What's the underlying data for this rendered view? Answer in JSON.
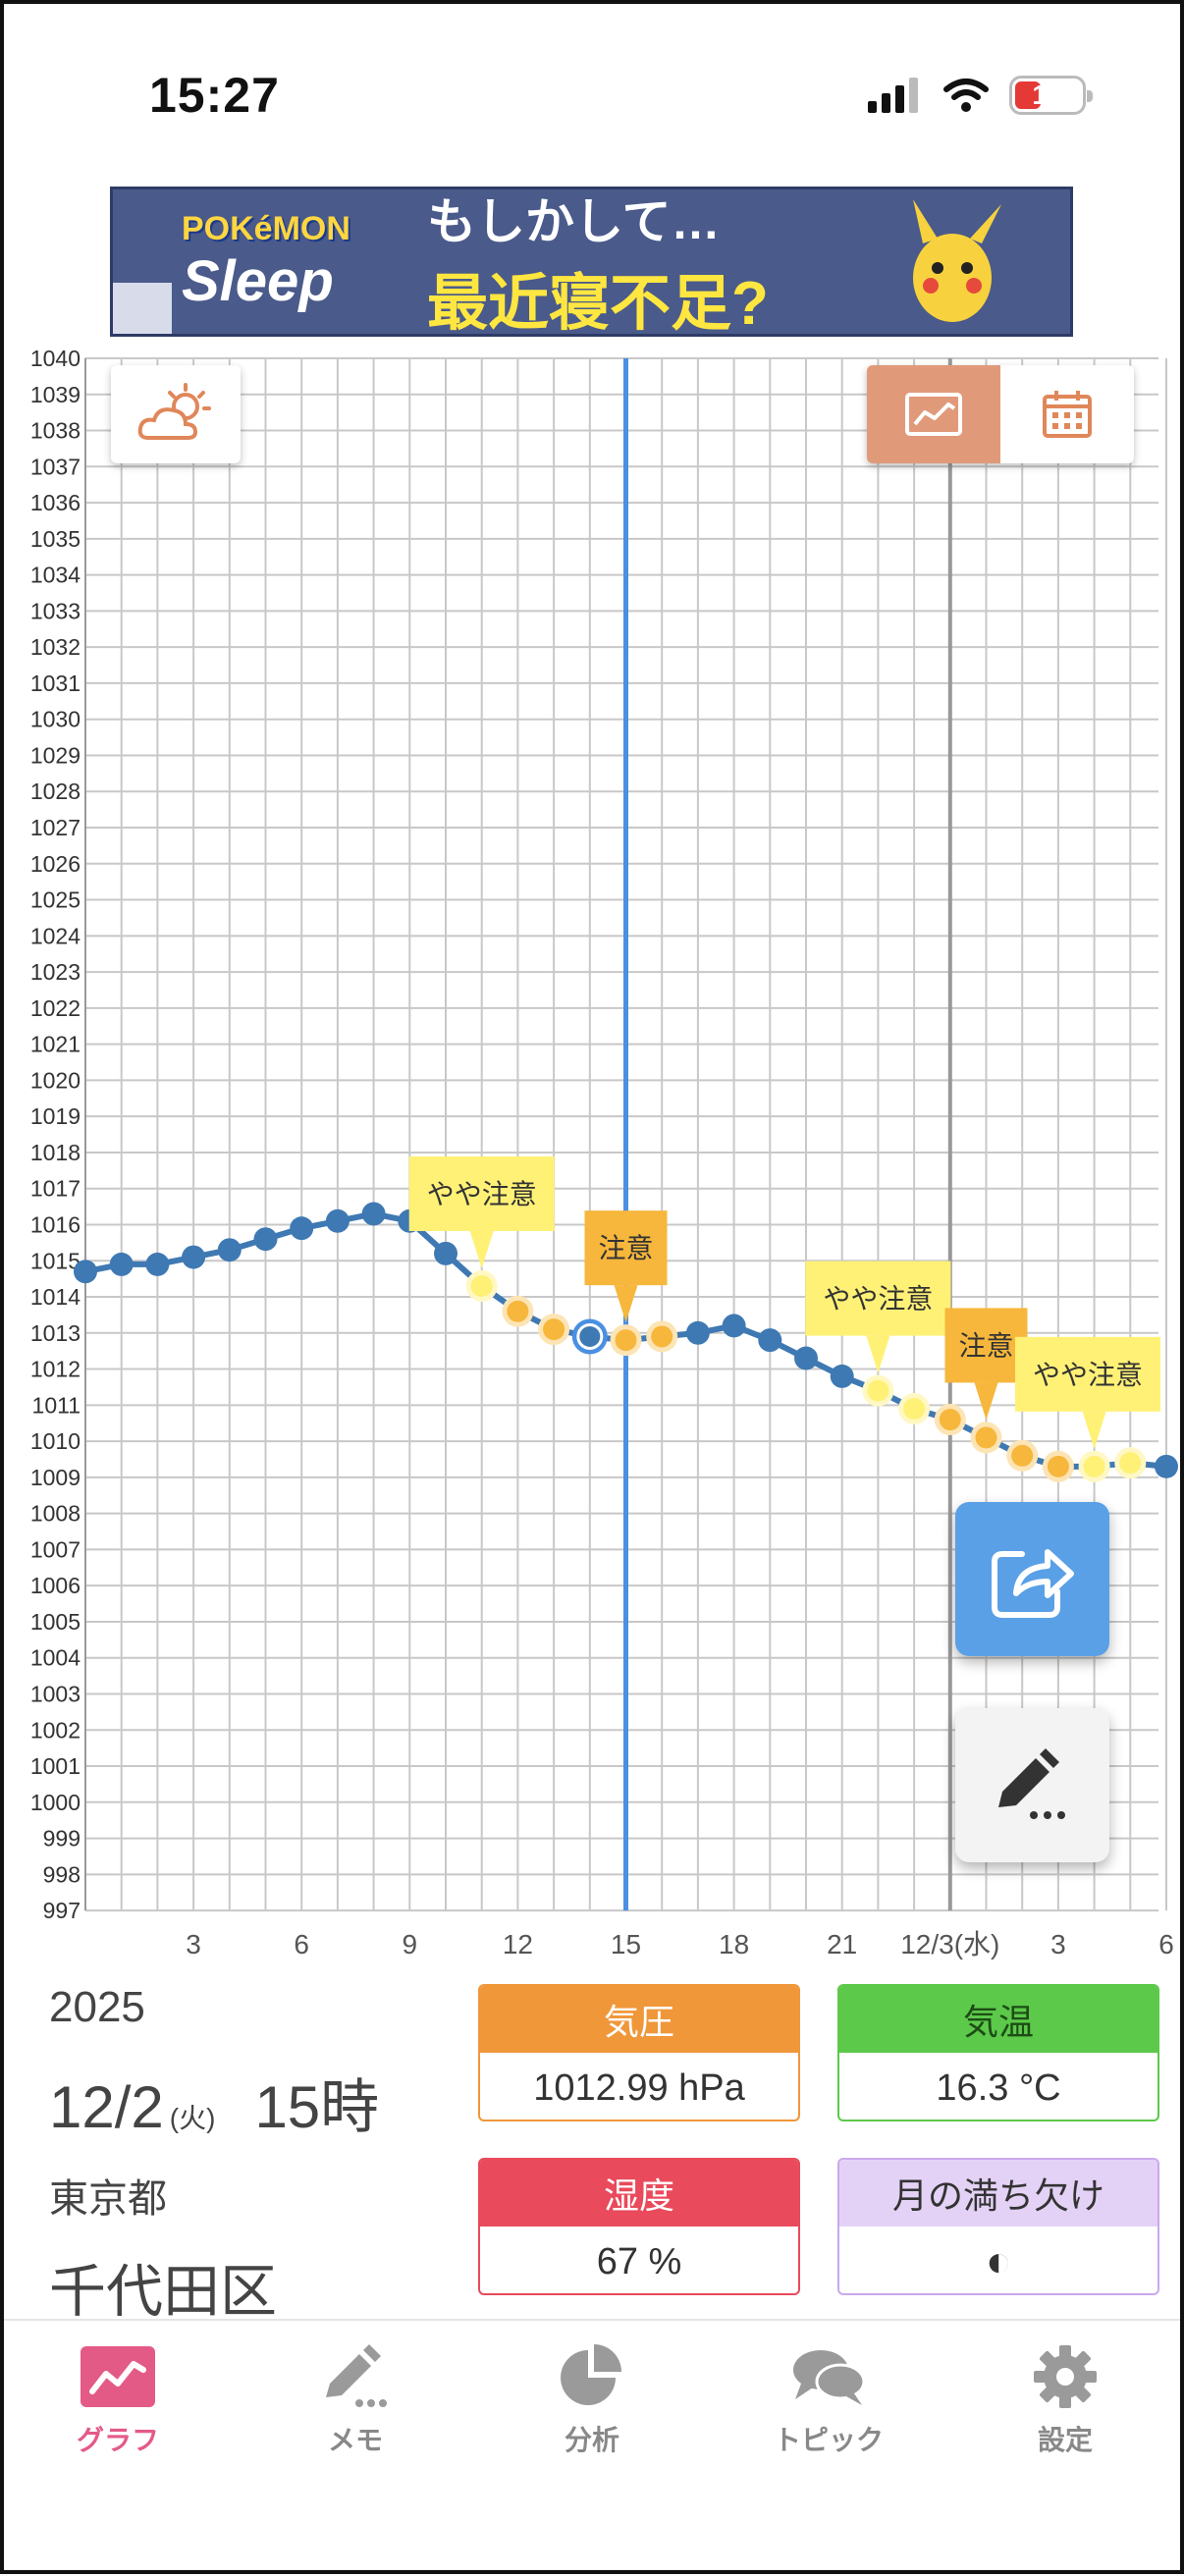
{
  "status_bar": {
    "time": "15:27",
    "battery": "19"
  },
  "ad": {
    "logo_top": "POKéMON",
    "logo_bottom": "Sleep",
    "line1": "もしかして…",
    "line2": "最近寝不足?"
  },
  "colors": {
    "line": "#3f79b3",
    "warn_light": "#fff176",
    "warn": "#f6b73c",
    "cursor": "#4a90e2",
    "grid": "#c8c8c8",
    "pressure": "#f0973a",
    "temperature": "#5cc94a",
    "humidity": "#e94a5c",
    "moon": "#ddc8f2",
    "tab_active": "#e45a87"
  },
  "chart_data": {
    "type": "line",
    "ylim": [
      997,
      1040
    ],
    "y_ticks": [
      1040,
      1039,
      1038,
      1037,
      1036,
      1035,
      1034,
      1033,
      1032,
      1031,
      1030,
      1029,
      1028,
      1027,
      1026,
      1025,
      1024,
      1023,
      1022,
      1021,
      1020,
      1019,
      1018,
      1017,
      1016,
      1015,
      1014,
      1013,
      1012,
      1011,
      1010,
      1009,
      1008,
      1007,
      1006,
      1005,
      1004,
      1003,
      1002,
      1001,
      1000,
      999,
      998,
      997
    ],
    "x_ticks": [
      {
        "hour": 3,
        "label": "3"
      },
      {
        "hour": 6,
        "label": "6"
      },
      {
        "hour": 9,
        "label": "9"
      },
      {
        "hour": 12,
        "label": "12"
      },
      {
        "hour": 15,
        "label": "15"
      },
      {
        "hour": 18,
        "label": "18"
      },
      {
        "hour": 21,
        "label": "21"
      },
      {
        "hour": 24,
        "label": "12/3(水)"
      },
      {
        "hour": 27,
        "label": "3"
      },
      {
        "hour": 30,
        "label": "6"
      }
    ],
    "x": [
      0,
      1,
      2,
      3,
      4,
      5,
      6,
      7,
      8,
      9,
      10,
      11,
      12,
      13,
      14,
      15,
      16,
      17,
      18,
      19,
      20,
      21,
      22,
      23,
      24,
      25,
      26,
      27,
      28,
      29,
      30
    ],
    "values": [
      1014.7,
      1014.9,
      1014.9,
      1015.1,
      1015.3,
      1015.6,
      1015.9,
      1016.1,
      1016.3,
      1016.1,
      1015.2,
      1014.3,
      1013.6,
      1013.1,
      1012.9,
      1012.8,
      1012.9,
      1013.0,
      1013.2,
      1012.8,
      1012.3,
      1011.8,
      1011.4,
      1010.9,
      1010.6,
      1010.1,
      1009.6,
      1009.3,
      1009.3,
      1009.4,
      1009.3
    ],
    "level": [
      "n",
      "n",
      "n",
      "n",
      "n",
      "n",
      "n",
      "n",
      "n",
      "n",
      "n",
      "y",
      "o",
      "o",
      "c",
      "o",
      "o",
      "n",
      "n",
      "n",
      "n",
      "n",
      "y",
      "y",
      "o",
      "o",
      "o",
      "o",
      "y",
      "y",
      "n"
    ],
    "selected_hour": 15,
    "day_boundary_hour": 24,
    "annotations": [
      {
        "hour": 11,
        "text": "やや注意",
        "kind": "y"
      },
      {
        "hour": 15,
        "text": "注意",
        "kind": "o"
      },
      {
        "hour": 22,
        "text": "やや注意",
        "kind": "y"
      },
      {
        "hour": 25,
        "text": "注意",
        "kind": "o"
      },
      {
        "hour": 28,
        "text": "やや注意",
        "kind": "y"
      }
    ]
  },
  "info": {
    "year": "2025",
    "date": "12/2",
    "dow": "(火)",
    "hour": "15時",
    "prefecture": "東京都",
    "city": "千代田区"
  },
  "cards": {
    "pressure": {
      "label": "気圧",
      "value": "1012.99 hPa"
    },
    "temperature": {
      "label": "気温",
      "value": "16.3 °C"
    },
    "humidity": {
      "label": "湿度",
      "value": "67 %"
    },
    "moon": {
      "label": "月の満ち欠け",
      "value": "◐"
    }
  },
  "tabs": [
    {
      "label": "グラフ",
      "icon": "graph-icon",
      "active": true
    },
    {
      "label": "メモ",
      "icon": "pencil-icon",
      "active": false
    },
    {
      "label": "分析",
      "icon": "pie-chart-icon",
      "active": false
    },
    {
      "label": "トピック",
      "icon": "chat-bubbles-icon",
      "active": false
    },
    {
      "label": "設定",
      "icon": "gear-icon",
      "active": false
    }
  ]
}
